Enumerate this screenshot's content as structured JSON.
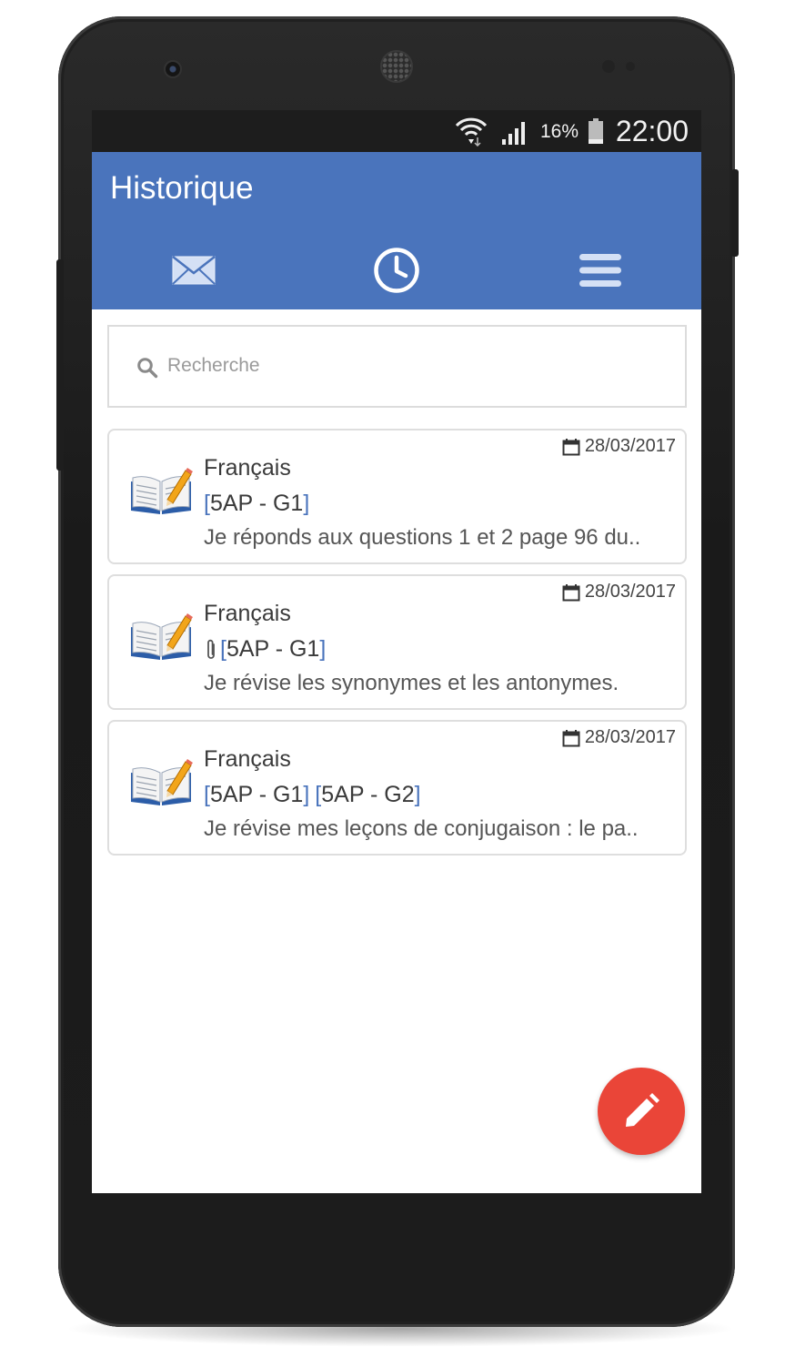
{
  "status_bar": {
    "battery_percent": "16%",
    "time": "22:00",
    "icons": [
      "wifi-icon",
      "signal-icon",
      "battery-icon"
    ]
  },
  "app_bar": {
    "title": "Historique",
    "tabs": [
      {
        "name": "messages",
        "icon": "mail-icon"
      },
      {
        "name": "history",
        "icon": "clock-icon",
        "active": true
      },
      {
        "name": "menu",
        "icon": "menu-icon"
      }
    ],
    "color": "#4a74bc"
  },
  "search": {
    "placeholder": "Recherche",
    "value": ""
  },
  "entries": [
    {
      "date": "28/03/2017",
      "subject": "Français",
      "attachment": false,
      "groups": [
        "5AP - G1"
      ],
      "text": "Je réponds aux questions 1 et 2 page 96 du.."
    },
    {
      "date": "28/03/2017",
      "subject": "Français",
      "attachment": true,
      "groups": [
        "5AP - G1"
      ],
      "text": "Je révise les synonymes et les antonymes."
    },
    {
      "date": "28/03/2017",
      "subject": "Français",
      "attachment": false,
      "groups": [
        "5AP - G1",
        "5AP - G2"
      ],
      "text": "Je révise mes leçons de conjugaison : le pa.."
    }
  ],
  "fab": {
    "icon": "pencil-icon",
    "color": "#ea4538"
  },
  "brackets": {
    "open": "[",
    "close": "]"
  }
}
